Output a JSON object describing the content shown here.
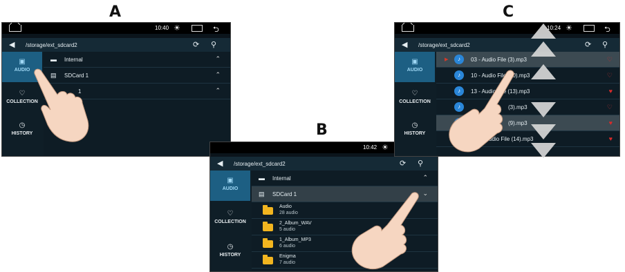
{
  "labels": {
    "a": "A",
    "b": "B",
    "c": "C"
  },
  "icons": {
    "home": "home-icon",
    "brightness": "brightness-icon",
    "recent": "recent-apps-icon",
    "back": "back-icon",
    "refresh": "refresh-icon",
    "search": "search-icon",
    "folder": "folder-icon",
    "music": "music-note-icon",
    "heart": "heart-icon",
    "hand": "pointing-hand-icon",
    "arrow_up": "arrow-up-icon",
    "arrow_down": "arrow-down-icon"
  },
  "sidebar": {
    "audio": "AUDIO",
    "collection": "COLLECTION",
    "history": "HISTORY"
  },
  "screen_a": {
    "time": "10:40",
    "path": "/storage/ext_sdcard2",
    "rows": [
      {
        "label": "Internal"
      },
      {
        "label": "SDCard 1"
      },
      {
        "label": "1"
      }
    ]
  },
  "screen_b": {
    "time": "10:42",
    "path": "/storage/ext_sdcard2",
    "internal": "Internal",
    "sdcard": "SDCard 1",
    "folders": [
      {
        "name": "Audio",
        "count": "28 audio"
      },
      {
        "name": "2_Album_WAV",
        "count": "5 audio"
      },
      {
        "name": "1_Album_MP3",
        "count": "6 audio"
      },
      {
        "name": "Enigma",
        "count": "7 audio"
      }
    ]
  },
  "screen_c": {
    "time": "10:24",
    "path": "/storage/ext_sdcard2",
    "tracks": [
      {
        "name": "03 - Audio File (3).mp3"
      },
      {
        "name": "10 - Audio File (10).mp3"
      },
      {
        "name": "13 - Audio File (13).mp3"
      },
      {
        "name": "(3).mp3"
      },
      {
        "name": "(9).mp3"
      },
      {
        "name": "udio File (14).mp3"
      }
    ]
  },
  "colors": {
    "accent": "#1d5f83",
    "folder": "#f2b51f",
    "heart": "#d92b2b",
    "note": "#2a86d8"
  }
}
